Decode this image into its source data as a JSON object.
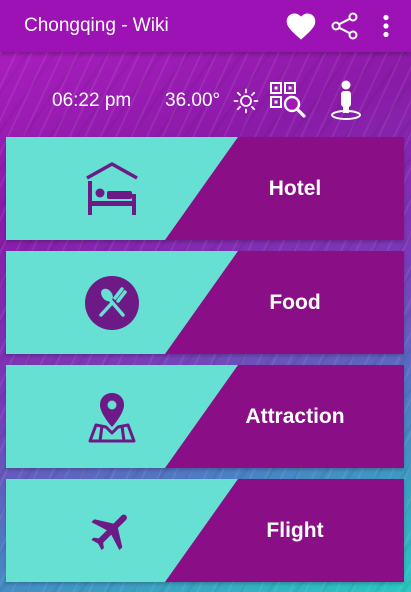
{
  "appbar": {
    "title": "Chongqing - Wiki",
    "icons": [
      "heart-icon",
      "share-icon",
      "more-vert-icon"
    ]
  },
  "info": {
    "time": "06:22 pm",
    "temperature": "36.00°",
    "icons": [
      "sun-icon",
      "qr-search-icon",
      "person-location-icon"
    ]
  },
  "cards": [
    {
      "label": "Hotel",
      "icon": "bed-icon"
    },
    {
      "label": "Food",
      "icon": "fork-spoon-icon"
    },
    {
      "label": "Attraction",
      "icon": "map-pin-icon"
    },
    {
      "label": "Flight",
      "icon": "airplane-icon"
    }
  ],
  "colors": {
    "appbar": "#9c12b4",
    "card_teal": "#66e0d3",
    "card_purple": "#8a0e86",
    "icon": "#6d1a86"
  }
}
